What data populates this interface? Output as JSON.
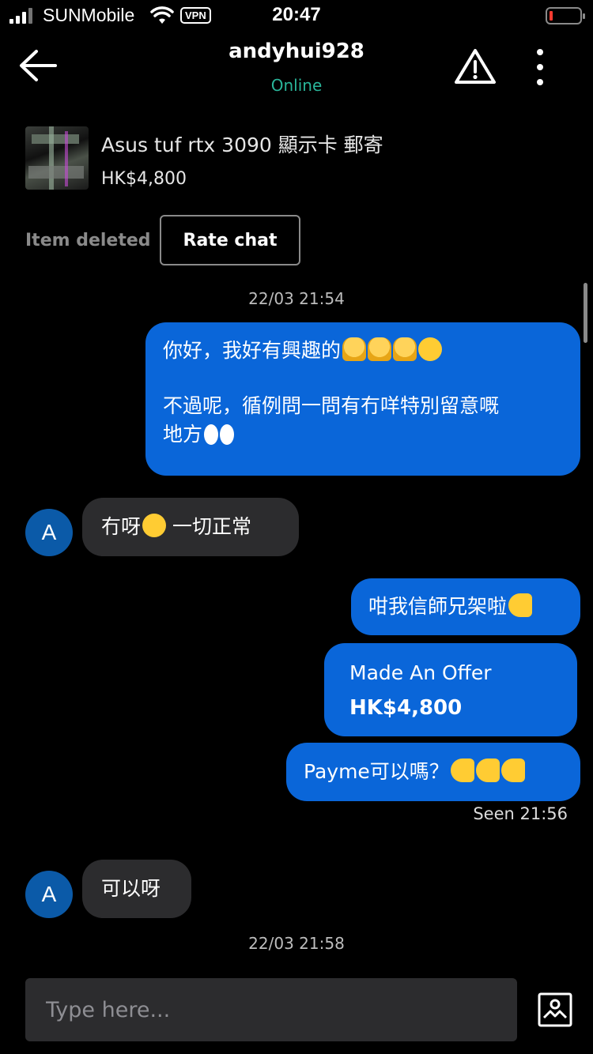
{
  "status_bar": {
    "carrier": "SUNMobile",
    "vpn": "VPN",
    "time": "20:47"
  },
  "header": {
    "title": "andyhui928",
    "status": "Online",
    "status_color": "#2ab59a"
  },
  "listing": {
    "title": "Asus tuf rtx 3090 顯示卡 郵寄",
    "price": "HK$4,800",
    "state": "Item deleted",
    "rate_button": "Rate chat"
  },
  "messages": {
    "ts1": "22/03 21:54",
    "m1_line1": "你好，我好有興趣的",
    "m1_line2": "不過呢，循例問一問有冇咩特別留意嘅",
    "m1_line3": "地方",
    "m2": "冇呀",
    "m2_tail": " 一切正常",
    "m3": "咁我信師兄架啦",
    "offer_label": "Made An Offer",
    "offer_amount": "HK$4,800",
    "m4": "Payme可以嗎？",
    "seen": "Seen 21:56",
    "m5": "可以呀",
    "ts2": "22/03 21:58"
  },
  "avatar_letter": "A",
  "input": {
    "placeholder": "Type here..."
  },
  "colors": {
    "outgoing_bubble": "#0a66d9",
    "incoming_bubble": "#2c2c2e",
    "avatar": "#0b5aa8",
    "background": "#000000"
  },
  "icons": [
    "back-arrow-icon",
    "report-warning-icon",
    "more-vertical-icon",
    "photo-upload-icon",
    "wifi-icon",
    "battery-icon",
    "signal-icon"
  ]
}
